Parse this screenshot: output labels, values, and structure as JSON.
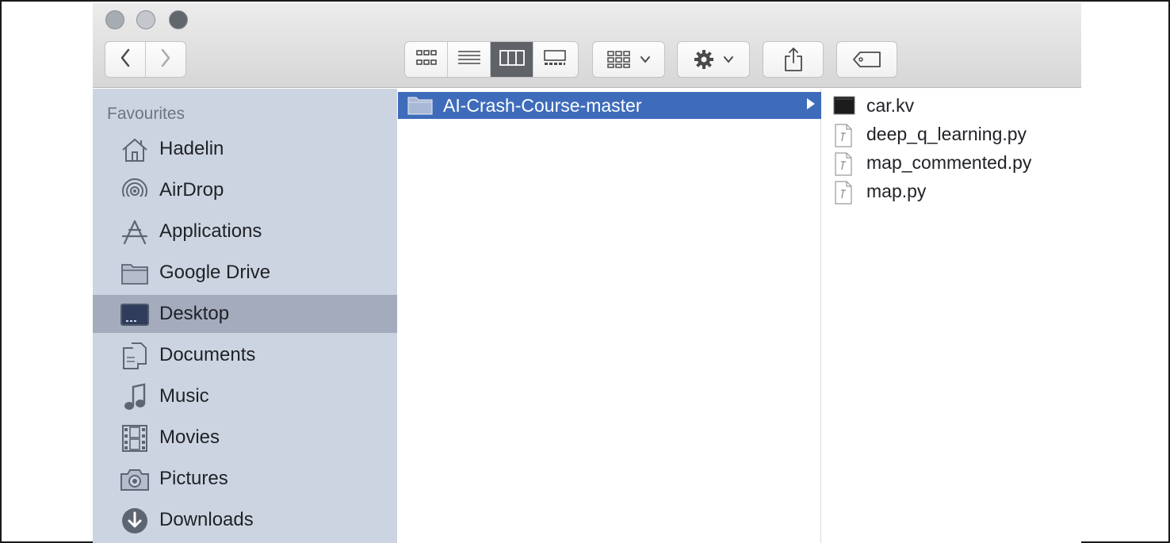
{
  "toolbar": {
    "back_icon": "chevron-left-icon",
    "forward_icon": "chevron-right-icon",
    "view_modes": [
      "icon-view-icon",
      "list-view-icon",
      "column-view-icon",
      "gallery-view-icon"
    ],
    "active_view": "column-view-icon",
    "arrange_icon": "arrange-grid-icon",
    "action_icon": "gear-icon",
    "share_icon": "share-icon",
    "tag_icon": "tag-icon"
  },
  "sidebar": {
    "section_title": "Favourites",
    "items": [
      {
        "label": "Hadelin",
        "icon": "home-icon"
      },
      {
        "label": "AirDrop",
        "icon": "airdrop-icon"
      },
      {
        "label": "Applications",
        "icon": "applications-icon"
      },
      {
        "label": "Google Drive",
        "icon": "folder-icon"
      },
      {
        "label": "Desktop",
        "icon": "desktop-icon",
        "selected": true
      },
      {
        "label": "Documents",
        "icon": "documents-icon"
      },
      {
        "label": "Music",
        "icon": "music-icon"
      },
      {
        "label": "Movies",
        "icon": "movies-icon"
      },
      {
        "label": "Pictures",
        "icon": "camera-icon"
      },
      {
        "label": "Downloads",
        "icon": "download-icon"
      }
    ]
  },
  "column1": {
    "selected_folder": "AI-Crash-Course-master"
  },
  "column2": {
    "files": [
      {
        "name": "car.kv",
        "icon": "kv-file-icon"
      },
      {
        "name": "deep_q_learning.py",
        "icon": "python-file-icon"
      },
      {
        "name": "map_commented.py",
        "icon": "python-file-icon"
      },
      {
        "name": "map.py",
        "icon": "python-file-icon"
      }
    ]
  },
  "colors": {
    "selection_blue": "#3e6cbb",
    "sidebar_bg": "#cdd4e1",
    "sidebar_selected": "#a4abbd"
  }
}
